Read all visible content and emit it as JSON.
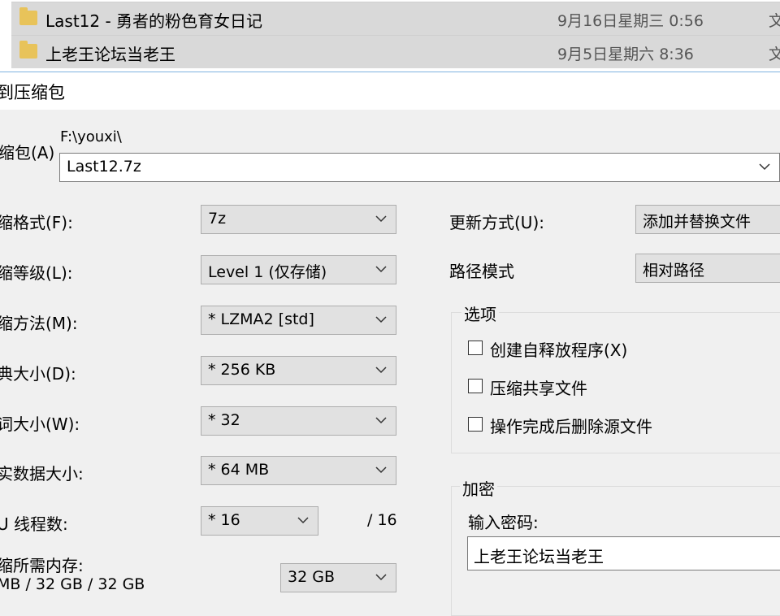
{
  "file_list": [
    {
      "name": "Last12 - 勇者的粉色育女日记",
      "date": "9月16日星期三 0:56",
      "type": "文"
    },
    {
      "name": "上老王论坛当老王",
      "date": "9月5日星期六 8:36",
      "type": "文"
    }
  ],
  "dialog": {
    "title": "到压缩包",
    "archive_label": "缩包(A)",
    "path": "F:\\youxi\\",
    "archive_name": "Last12.7z"
  },
  "left": {
    "format_label": "缩格式(F):",
    "format_value": "7z",
    "level_label": "缩等级(L):",
    "level_value": "Level 1 (仅存储)",
    "method_label": "缩方法(M):",
    "method_value": "* LZMA2 [std]",
    "dict_label": "典大小(D):",
    "dict_value": "* 256 KB",
    "word_label": "词大小(W):",
    "word_value": "* 32",
    "solid_label": "实数据大小:",
    "solid_value": "* 64 MB",
    "threads_label": "U 线程数:",
    "threads_value": "* 16",
    "threads_max": "/ 16",
    "memory_label": "缩所需内存:",
    "memory_detail": "MB / 32 GB / 32 GB",
    "memory_value": "32 GB"
  },
  "right": {
    "update_label": "更新方式(U):",
    "update_value": "添加并替换文件",
    "path_label": "路径模式",
    "path_value": "相对路径",
    "options_title": "选项",
    "opt_sfx": "创建自释放程序(X)",
    "opt_shared": "压缩共享文件",
    "opt_delete": "操作完成后删除源文件",
    "encrypt_title": "加密",
    "password_label": "输入密码:",
    "password_value": "上老王论坛当老王"
  }
}
